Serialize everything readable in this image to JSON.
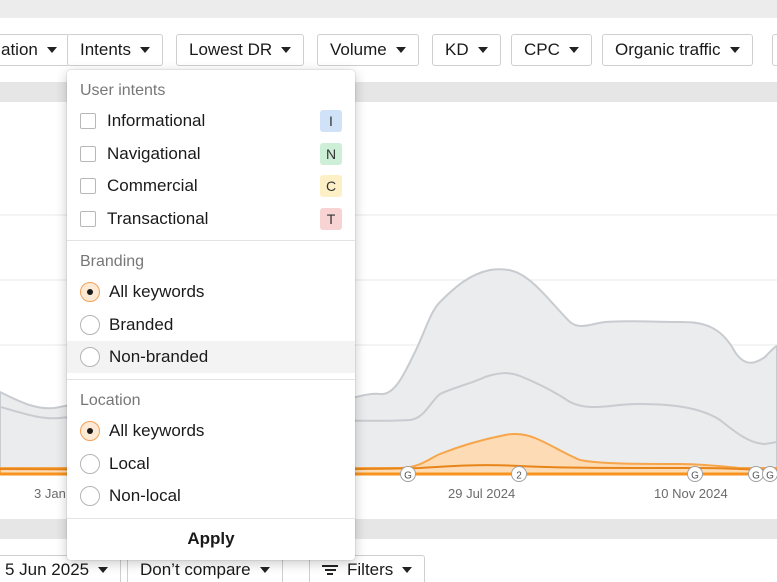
{
  "filters": [
    {
      "label": "ation",
      "name": "position-filter"
    },
    {
      "label": "Intents",
      "name": "intents-filter"
    },
    {
      "label": "Lowest DR",
      "name": "lowest-dr-filter"
    },
    {
      "label": "Volume",
      "name": "volume-filter"
    },
    {
      "label": "KD",
      "name": "kd-filter"
    },
    {
      "label": "CPC",
      "name": "cpc-filter"
    },
    {
      "label": "Organic traffic",
      "name": "organic-traffic-filter"
    }
  ],
  "dropdown": {
    "user_intents_title": "User intents",
    "intents": [
      {
        "label": "Informational",
        "badge": "I",
        "badge_color": "#cfe2f7"
      },
      {
        "label": "Navigational",
        "badge": "N",
        "badge_color": "#cdeed7"
      },
      {
        "label": "Commercial",
        "badge": "C",
        "badge_color": "#fdf0c6"
      },
      {
        "label": "Transactional",
        "badge": "T",
        "badge_color": "#f8d3d3"
      }
    ],
    "branding_title": "Branding",
    "branding": [
      {
        "label": "All keywords",
        "checked": true
      },
      {
        "label": "Branded",
        "checked": false
      },
      {
        "label": "Non-branded",
        "checked": false
      }
    ],
    "location_title": "Location",
    "location": [
      {
        "label": "All keywords",
        "checked": true
      },
      {
        "label": "Local",
        "checked": false
      },
      {
        "label": "Non-local",
        "checked": false
      }
    ],
    "apply_label": "Apply"
  },
  "chart": {
    "x_labels": [
      "3 Jan",
      "29 Jul 2024",
      "10 Nov 2024"
    ],
    "markers": [
      "G",
      "2",
      "G",
      "G",
      "G"
    ],
    "colors": {
      "accent": "#f7931e",
      "area_fill": "#fddcb5",
      "grey_area": "#ebecee"
    }
  },
  "footer": {
    "date_label": "5 Jun 2025",
    "compare_label": "Don’t compare",
    "filters_label": "Filters"
  }
}
